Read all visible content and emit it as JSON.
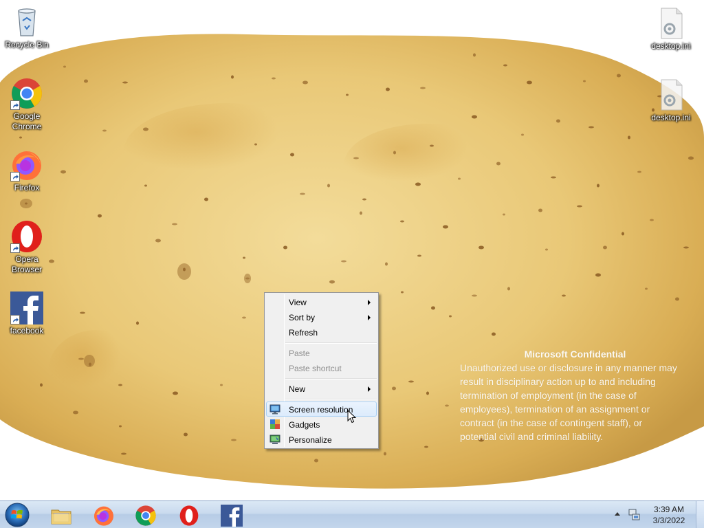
{
  "desktop": {
    "icons_left": [
      {
        "label": "Recycle Bin",
        "icon": "recycle-bin-icon"
      },
      {
        "label": "Google\nChrome",
        "icon": "chrome-icon"
      },
      {
        "label": "Firefox",
        "icon": "firefox-icon"
      },
      {
        "label": "Opera\nBrowser",
        "icon": "opera-icon"
      },
      {
        "label": "facebook",
        "icon": "facebook-icon"
      }
    ],
    "icons_right": [
      {
        "label": "desktop.ini",
        "icon": "settings-file-icon"
      },
      {
        "label": "desktop.ini",
        "icon": "settings-file-icon"
      }
    ]
  },
  "watermark": {
    "title": "Microsoft Confidential",
    "lines": [
      "Unauthorized use or disclosure in any manner may",
      "result in disciplinary action up to and including",
      "termination of employment (in the case of",
      "employees), termination of an assignment or",
      "contract (in the case of contingent staff), or",
      "potential civil and criminal liability."
    ]
  },
  "context_menu": {
    "items": [
      {
        "label": "View",
        "submenu": true,
        "disabled": false
      },
      {
        "label": "Sort by",
        "submenu": true,
        "disabled": false
      },
      {
        "label": "Refresh",
        "submenu": false,
        "disabled": false
      },
      {
        "label": "Paste",
        "submenu": false,
        "disabled": true
      },
      {
        "label": "Paste shortcut",
        "submenu": false,
        "disabled": true
      },
      {
        "label": "New",
        "submenu": true,
        "disabled": false
      },
      {
        "label": "Screen resolution",
        "submenu": false,
        "disabled": false,
        "icon": "screen-resolution-icon",
        "hovered": true
      },
      {
        "label": "Gadgets",
        "submenu": false,
        "disabled": false,
        "icon": "gadgets-icon"
      },
      {
        "label": "Personalize",
        "submenu": false,
        "disabled": false,
        "icon": "personalize-icon"
      }
    ]
  },
  "taskbar": {
    "start": "start-orb-icon",
    "pinned": [
      {
        "name": "file-explorer",
        "icon": "folder-icon"
      },
      {
        "name": "firefox",
        "icon": "firefox-icon"
      },
      {
        "name": "chrome",
        "icon": "chrome-icon"
      },
      {
        "name": "opera",
        "icon": "opera-icon"
      },
      {
        "name": "facebook",
        "icon": "facebook-icon"
      }
    ],
    "clock": {
      "time": "3:39 AM",
      "date": "3/3/2022"
    }
  },
  "colors": {
    "potato": "#e8c879",
    "potato_shade": "#d8ac52",
    "taskbar": "#c9daee",
    "menu_bg": "#f0f0f0",
    "menu_hover_border": "#a8d0f5"
  }
}
